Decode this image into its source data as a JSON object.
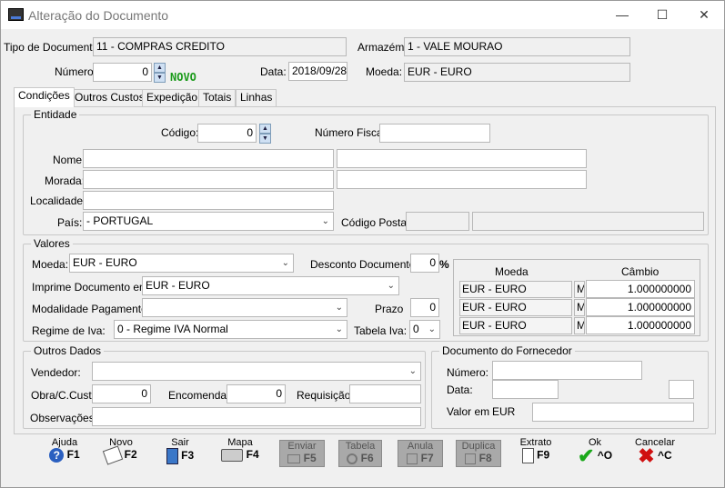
{
  "window": {
    "title": "Alteração do Documento"
  },
  "header": {
    "tipo_label": "Tipo de Documento:",
    "tipo_value": "11 - COMPRAS CREDITO",
    "armazem_label": "Armazém:",
    "armazem_value": "1 - VALE MOURAO",
    "numero_label": "Número:",
    "numero_value": "0",
    "novo_badge": "NOVO",
    "data_label": "Data:",
    "data_value": "2018/09/28",
    "moeda_label": "Moeda:",
    "moeda_value": "EUR - EURO"
  },
  "tabs": [
    "Condições",
    "Outros Custos",
    "Expedição",
    "Totais",
    "Linhas"
  ],
  "entidade": {
    "group": "Entidade",
    "codigo_label": "Código:",
    "codigo_value": "0",
    "nif_label": "Número Fiscal:",
    "nif_value": "",
    "nome_label": "Nome:",
    "morada_label": "Morada:",
    "localidade_label": "Localidade:",
    "pais_label": "País:",
    "pais_value": "- PORTUGAL",
    "cp_label": "Código Postal:"
  },
  "valores": {
    "group": "Valores",
    "moeda_label": "Moeda:",
    "moeda_value": "EUR - EURO",
    "desconto_label": "Desconto Documento:",
    "desconto_value": "0",
    "desconto_unit": "%",
    "imprime_label": "Imprime Documento em:",
    "imprime_value": "EUR - EURO",
    "modalidade_label": "Modalidade Pagamento:",
    "modalidade_value": "",
    "prazo_label": "Prazo",
    "prazo_value": "0",
    "regime_label": "Regime de Iva:",
    "regime_value": "0 - Regime IVA Normal",
    "tabela_label": "Tabela Iva:",
    "tabela_value": "0",
    "cambio_table": {
      "headers": [
        "Moeda",
        "Câmbio"
      ],
      "rows": [
        {
          "moeda": "EUR - EURO",
          "flag": "M",
          "cambio": "1.000000000"
        },
        {
          "moeda": "EUR - EURO",
          "flag": "M",
          "cambio": "1.000000000"
        },
        {
          "moeda": "EUR - EURO",
          "flag": "M",
          "cambio": "1.000000000"
        }
      ]
    }
  },
  "outros": {
    "group": "Outros Dados",
    "vendedor_label": "Vendedor:",
    "obra_label": "Obra/C.Custo",
    "obra_value": "0",
    "encomenda_label": "Encomenda",
    "encomenda_value": "0",
    "requisicao_label": "Requisição",
    "observacoes_label": "Observações:"
  },
  "fornecedor": {
    "group": "Documento do Fornecedor",
    "numero_label": "Número:",
    "data_label": "Data:",
    "valor_label": "Valor em",
    "valor_currency": "EUR"
  },
  "toolbar": [
    {
      "label": "Ajuda",
      "key": "F1",
      "icon": "help-icon"
    },
    {
      "label": "Novo",
      "key": "F2",
      "icon": "new-document-icon"
    },
    {
      "label": "Sair",
      "key": "F3",
      "icon": "exit-door-icon"
    },
    {
      "label": "Mapa",
      "key": "F4",
      "icon": "printer-icon"
    },
    {
      "label": "Enviar",
      "key": "F5",
      "icon": "send-icon"
    },
    {
      "label": "Tabela",
      "key": "F6",
      "icon": "table-search-icon"
    },
    {
      "label": "Anula",
      "key": "F7",
      "icon": "cancel-doc-icon"
    },
    {
      "label": "Duplica",
      "key": "F8",
      "icon": "duplicate-icon"
    },
    {
      "label": "Extrato",
      "key": "F9",
      "icon": "statement-icon"
    },
    {
      "label": "Ok",
      "key": "^O",
      "icon": "checkmark-icon"
    },
    {
      "label": "Cancelar",
      "key": "^C",
      "icon": "x-icon"
    }
  ],
  "colors": {
    "novo": "#1a9a1a",
    "ok": "#1aa81a",
    "cancel": "#d01010",
    "help": "#2a5fc0"
  }
}
